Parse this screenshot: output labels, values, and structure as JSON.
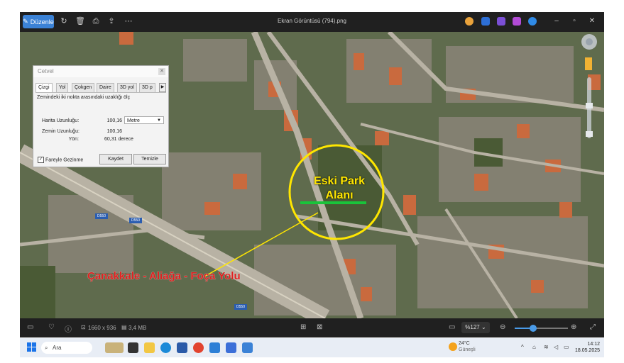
{
  "toolbar": {
    "edit_label": "Düzenle",
    "title": "Ekran Görüntüsü (794).png",
    "icons": [
      "rotate-icon",
      "delete-icon",
      "print-icon",
      "share-icon",
      "more-icon"
    ],
    "window_controls": [
      "minimize",
      "maximize",
      "close"
    ]
  },
  "map": {
    "circle_label_line1": "Eski Park",
    "circle_label_line2": "Alanı",
    "road_label": "Çanakkale - Aliağa - Foça Yolu",
    "road_shields": [
      "D550",
      "D550",
      "D550"
    ],
    "accent_yellow": "#ffe600",
    "accent_red": "#e02020",
    "accent_green": "#19c43a"
  },
  "cetvel": {
    "title": "Cetvel",
    "tabs": [
      "Çizgi",
      "Yol",
      "Çokgen",
      "Daire",
      "3D yol",
      "3D p"
    ],
    "description": "Zemindeki iki nokta arasındaki uzaklığı ölç",
    "map_length_label": "Harita Uzunluğu:",
    "map_length_value": "100,16",
    "unit": "Metre",
    "ground_length_label": "Zemin Uzunluğu:",
    "ground_length_value": "100,16",
    "heading_label": "Yön:",
    "heading_value": "60,31 derece",
    "mouse_nav_label": "Fareyle Gezinme",
    "save_label": "Kaydet",
    "clear_label": "Temizle"
  },
  "viewer_bottom": {
    "dimensions": "1660 x 936",
    "size": "3,4 MB",
    "zoom": "%127",
    "zoom_fraction": 0.35
  },
  "taskbar": {
    "search_placeholder": "Ara",
    "temperature": "24°C",
    "weather": "Güneşli",
    "time": "14:12",
    "date": "18.05.2025"
  }
}
